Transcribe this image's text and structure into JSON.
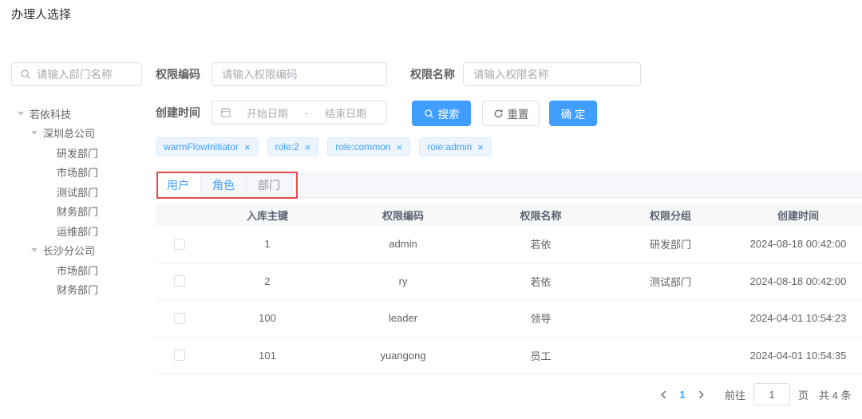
{
  "page": {
    "title": "办理人选择"
  },
  "colors": {
    "accent": "#409eff",
    "tag_bg": "#ecf5ff",
    "tag_border": "#d9ecff",
    "annotation_red": "#e34d4d",
    "input_border": "#dcdfe6",
    "table_line": "#ebeef5",
    "tab_bar_bg": "#f5f7fa"
  },
  "icons": {
    "search": "search-icon",
    "refresh": "refresh-icon",
    "calendar": "calendar-icon",
    "caret_down": "caret-down-icon",
    "close_glyph": "×"
  },
  "sidebar": {
    "search_placeholder": "请输入部门名称",
    "tree": [
      {
        "label": "若依科技"
      },
      {
        "label": "深圳总公司"
      },
      {
        "label": "研发部门"
      },
      {
        "label": "市场部门"
      },
      {
        "label": "测试部门"
      },
      {
        "label": "财务部门"
      },
      {
        "label": "运维部门"
      },
      {
        "label": "长沙分公司"
      },
      {
        "label": "市场部门"
      },
      {
        "label": "财务部门"
      }
    ]
  },
  "filters": {
    "perm_code": {
      "label": "权限编码",
      "placeholder": "请输入权限编码",
      "value": ""
    },
    "perm_name": {
      "label": "权限名称",
      "placeholder": "请输入权限名称",
      "value": ""
    },
    "create_time": {
      "label": "创建时间",
      "start_placeholder": "开始日期",
      "separator": "-",
      "end_placeholder": "结束日期"
    },
    "buttons": {
      "search": "搜索",
      "reset": "重置",
      "confirm": "确 定"
    }
  },
  "tags": [
    {
      "label": "warmFlowInitiator"
    },
    {
      "label": "role:2"
    },
    {
      "label": "role:common"
    },
    {
      "label": "role:admin"
    }
  ],
  "tabs": [
    {
      "label": "用户"
    },
    {
      "label": "角色"
    },
    {
      "label": "部门"
    }
  ],
  "table": {
    "columns": {
      "id": "入库主键",
      "code": "权限编码",
      "name": "权限名称",
      "group": "权限分组",
      "created": "创建时间"
    },
    "rows": [
      {
        "id": "1",
        "code": "admin",
        "name": "若依",
        "group": "研发部门",
        "created": "2024-08-18 00:42:00"
      },
      {
        "id": "2",
        "code": "ry",
        "name": "若依",
        "group": "测试部门",
        "created": "2024-08-18 00:42:00"
      },
      {
        "id": "100",
        "code": "leader",
        "name": "领导",
        "group": "",
        "created": "2024-04-01 10:54:23"
      },
      {
        "id": "101",
        "code": "yuangong",
        "name": "员工",
        "group": "",
        "created": "2024-04-01 10:54:35"
      }
    ]
  },
  "pagination": {
    "current_page": "1",
    "goto_label": "前往",
    "goto_value": "1",
    "page_unit": "页",
    "total_text": "共 4 条"
  }
}
